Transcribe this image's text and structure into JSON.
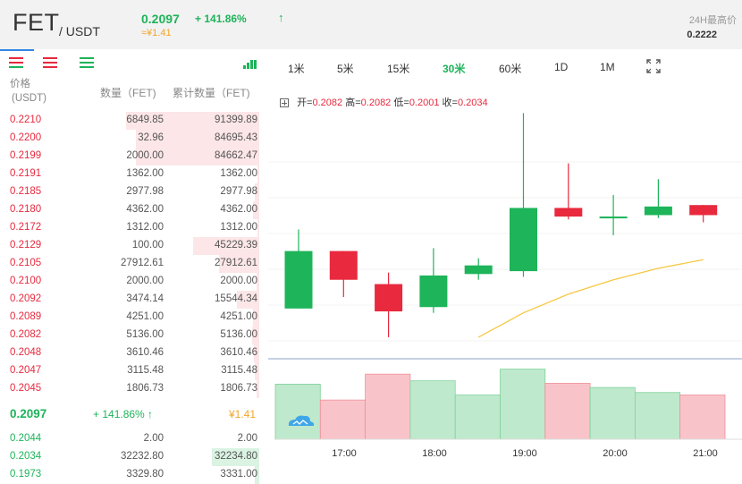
{
  "header": {
    "base": "FET",
    "quote": "/ USDT",
    "last_price": "0.2097",
    "cny_price": "≈¥1.41",
    "change": "+ 141.86%",
    "change_arrow": "↑",
    "high24_label": "24H最高价",
    "high24_value": "0.2222"
  },
  "orderbook": {
    "col_price": "价格",
    "col_price_unit": "(USDT)",
    "col_amount": "数量（FET)",
    "col_cum": "累计数量（FET)",
    "asks": [
      {
        "price": "0.2210",
        "amount": "6849.85",
        "cum": "91399.89"
      },
      {
        "price": "0.2200",
        "amount": "32.96",
        "cum": "84695.43"
      },
      {
        "price": "0.2199",
        "amount": "2000.00",
        "cum": "84662.47"
      },
      {
        "price": "0.2191",
        "amount": "1362.00",
        "cum": "1362.00"
      },
      {
        "price": "0.2185",
        "amount": "2977.98",
        "cum": "2977.98"
      },
      {
        "price": "0.2180",
        "amount": "4362.00",
        "cum": "4362.00"
      },
      {
        "price": "0.2172",
        "amount": "1312.00",
        "cum": "1312.00"
      },
      {
        "price": "0.2129",
        "amount": "100.00",
        "cum": "45229.39"
      },
      {
        "price": "0.2105",
        "amount": "27912.61",
        "cum": "27912.61"
      },
      {
        "price": "0.2100",
        "amount": "2000.00",
        "cum": "2000.00"
      },
      {
        "price": "0.2092",
        "amount": "3474.14",
        "cum": "15544.34"
      },
      {
        "price": "0.2089",
        "amount": "4251.00",
        "cum": "4251.00"
      },
      {
        "price": "0.2082",
        "amount": "5136.00",
        "cum": "5136.00"
      },
      {
        "price": "0.2048",
        "amount": "3610.46",
        "cum": "3610.46"
      },
      {
        "price": "0.2047",
        "amount": "3115.48",
        "cum": "3115.48"
      },
      {
        "price": "0.2045",
        "amount": "1806.73",
        "cum": "1806.73"
      }
    ],
    "mid_price": "0.2097",
    "mid_change": "+ 141.86% ↑",
    "mid_cny": "¥1.41",
    "bids": [
      {
        "price": "0.2044",
        "amount": "2.00",
        "cum": "2.00"
      },
      {
        "price": "0.2034",
        "amount": "32232.80",
        "cum": "32234.80"
      },
      {
        "price": "0.1973",
        "amount": "3329.80",
        "cum": "3331.00"
      }
    ]
  },
  "periods": [
    "1米",
    "5米",
    "15米",
    "30米",
    "60米",
    "1D",
    "1M"
  ],
  "active_period": "30米",
  "ohlc": {
    "open_label": "开=",
    "open": "0.2082",
    "high_label": "高=",
    "high": "0.2082",
    "low_label": "低=",
    "low": "0.2001",
    "close_label": "收=",
    "close": "0.2034"
  },
  "colors": {
    "up": "#1db45a",
    "down": "#e8293e",
    "cny": "#f3a52b",
    "ma": "#f5c842",
    "tab_active": "#2f86e8"
  },
  "chart_data": {
    "type": "candlestick",
    "x_ticks": [
      "17:00",
      "18:00",
      "19:00",
      "20:00",
      "21:00"
    ],
    "candles": [
      {
        "open": 0.205,
        "close": 0.201,
        "high": 0.2065,
        "low": 0.201,
        "volume": 0.66,
        "dir": "down-green"
      },
      {
        "open": 0.205,
        "close": 0.203,
        "high": 0.205,
        "low": 0.2018,
        "volume": 0.47,
        "dir": "red"
      },
      {
        "open": 0.2027,
        "close": 0.2008,
        "high": 0.2035,
        "low": 0.199,
        "volume": 0.78,
        "dir": "red"
      },
      {
        "open": 0.2011,
        "close": 0.2033,
        "high": 0.2052,
        "low": 0.2007,
        "volume": 0.7,
        "dir": "green"
      },
      {
        "open": 0.2034,
        "close": 0.204,
        "high": 0.2045,
        "low": 0.203,
        "volume": 0.53,
        "dir": "green"
      },
      {
        "open": 0.2036,
        "close": 0.208,
        "high": 0.2146,
        "low": 0.2032,
        "volume": 0.84,
        "dir": "green"
      },
      {
        "open": 0.208,
        "close": 0.2074,
        "high": 0.2111,
        "low": 0.2072,
        "volume": 0.67,
        "dir": "red"
      },
      {
        "open": 0.2074,
        "close": 0.2074,
        "high": 0.2089,
        "low": 0.2061,
        "volume": 0.62,
        "dir": "green"
      },
      {
        "open": 0.2075,
        "close": 0.2081,
        "high": 0.21,
        "low": 0.2073,
        "volume": 0.56,
        "dir": "green"
      },
      {
        "open": 0.2082,
        "close": 0.2075,
        "high": 0.2082,
        "low": 0.207,
        "volume": 0.53,
        "dir": "red"
      }
    ],
    "ma": [
      null,
      null,
      null,
      null,
      0.199,
      0.2007,
      0.202,
      0.203,
      0.2038,
      0.2044
    ]
  }
}
